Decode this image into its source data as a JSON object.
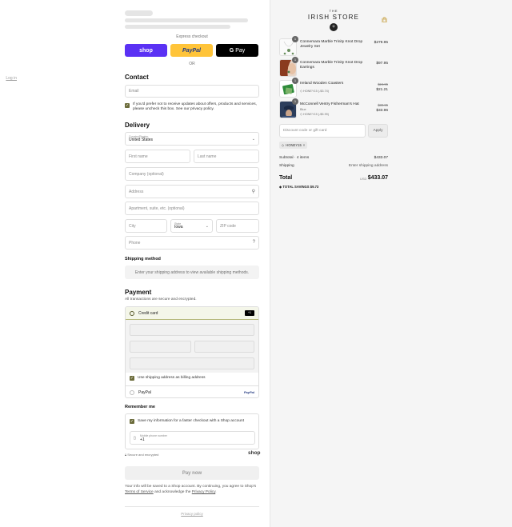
{
  "express": {
    "label": "Express checkout",
    "shop": "shop",
    "paypal": "PayPal",
    "gpay_g": "G",
    "gpay": "Pay",
    "or": "OR"
  },
  "contact": {
    "title": "Contact",
    "login": "Log in",
    "email_placeholder": "Email",
    "optout_text": "If you'd prefer not to receive updates about offers, products and services, please uncheck this box. See our privacy policy."
  },
  "delivery": {
    "title": "Delivery",
    "country_label": "Country/Region",
    "country_value": "United States",
    "first_name": "First name",
    "last_name": "Last name",
    "company": "Company (optional)",
    "address": "Address",
    "apartment": "Apartment, suite, etc. (optional)",
    "city": "City",
    "state_label": "State",
    "state_value": "Iowa",
    "zip": "ZIP code",
    "phone": "Phone"
  },
  "shipping": {
    "title": "Shipping method",
    "note": "Enter your shipping address to view available shipping methods."
  },
  "payment": {
    "title": "Payment",
    "subtitle": "All transactions are secure and encrypted.",
    "credit_card": "Credit card",
    "cc_badge": "+1",
    "billing": "Use shipping address as billing address",
    "paypal": "PayPal",
    "paypal_logo": "PayPal"
  },
  "remember": {
    "title": "Remember me",
    "save_text": "Save my information for a faster checkout with a Shop account",
    "phone_label": "Mobile phone number",
    "phone_value": "+1",
    "secure": "Secure and encrypted",
    "shop_logo": "shop"
  },
  "paynow": "Pay now",
  "legal": {
    "text1": "Your info will be saved to a Shop account. By continuing, you agree to Shop's",
    "tos": "Terms of Service",
    "text2": "and acknowledge the",
    "privacy": "Privacy Policy",
    "end": "."
  },
  "privacy_link": "Privacy policy",
  "brand": {
    "the": "THE",
    "name": "IRISH STORE"
  },
  "items": [
    {
      "qty": "1",
      "name": "Connemara Marble Trinity Knot Drop Jewelry Set",
      "price": "$279.95"
    },
    {
      "qty": "1",
      "name": "Connemara Marble Trinity Knot Drop Earrings",
      "price": "$97.95"
    },
    {
      "qty": "1",
      "name": "Ireland Wooden Coasters",
      "discount": "HONEY15 (-$3.74)",
      "old": "$24.95",
      "new": "$21.21"
    },
    {
      "qty": "1",
      "name": "McConnell Ventry Fisherman's Hat",
      "variant": "Blue",
      "discount": "HONEY15 (-$5.99)",
      "old": "$39.95",
      "new": "$33.96"
    }
  ],
  "discount": {
    "placeholder": "Discount code or gift card",
    "apply": "Apply",
    "chip": "HONEY15",
    "chip_close": "×"
  },
  "summary": {
    "subtotal_label": "Subtotal · 4 items",
    "subtotal": "$433.07",
    "shipping_label": "Shipping",
    "shipping": "Enter shipping address",
    "total_label": "Total",
    "currency": "USD",
    "total": "$433.07",
    "savings_label": "TOTAL SAVINGS",
    "savings": "$9.73"
  },
  "colors": {
    "shop": "#5a31f4",
    "paypal": "#ffc439",
    "accent_olive": "#6b6b3a"
  }
}
